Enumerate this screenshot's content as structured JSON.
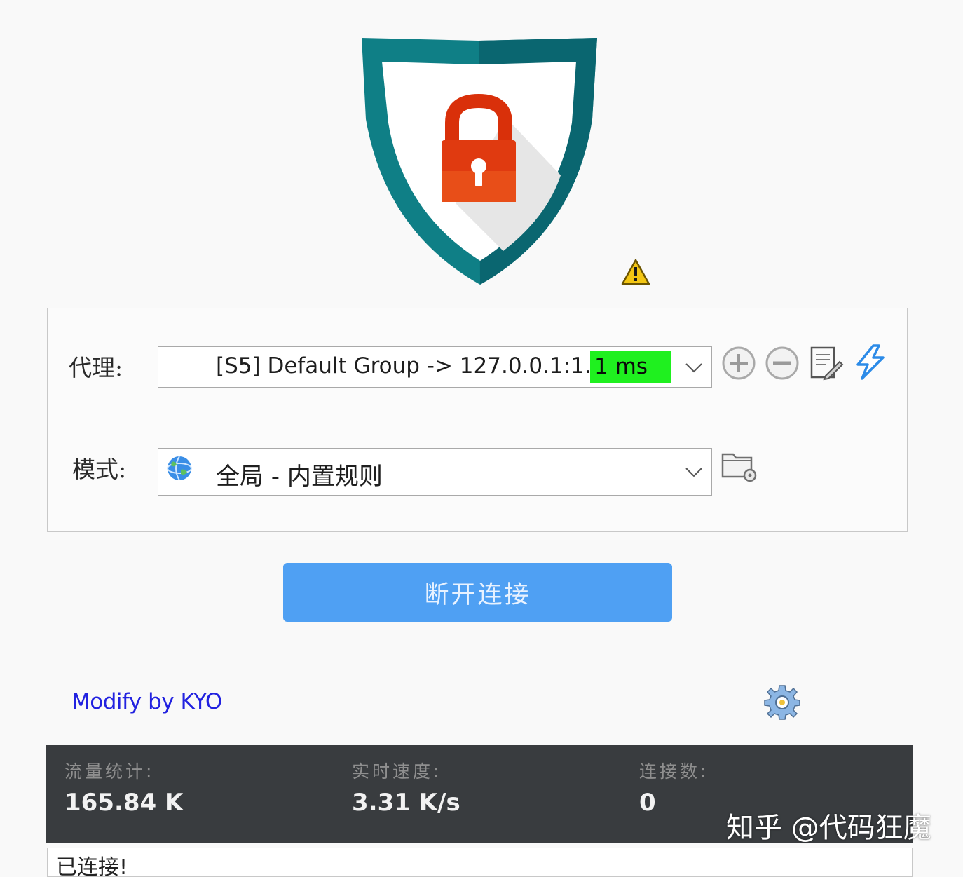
{
  "header": {
    "shield_icon": "shield-lock-icon",
    "status_icon": "warning-icon"
  },
  "proxy": {
    "label": "代理:",
    "value": "[S5] Default Group -> 127.0.0.1:1...",
    "latency": "1 ms",
    "latency_color": "#1ff01f",
    "actions": [
      "add-icon",
      "remove-icon",
      "edit-icon",
      "test-icon"
    ]
  },
  "mode": {
    "label": "模式:",
    "value": "全局 - 内置规则",
    "icon": "globe-icon",
    "action": "folder-settings-icon"
  },
  "connect_button": {
    "label": "断开连接",
    "color": "#4fa0f3"
  },
  "footer": {
    "modify_text": "Modify by KYO",
    "modify_color": "#2222e0",
    "settings_icon": "gear-icon"
  },
  "stats": {
    "traffic_label": "流量统计:",
    "traffic_value": "165.84 K",
    "speed_label": "实时速度:",
    "speed_value": "3.31 K/s",
    "connections_label": "连接数:",
    "connections_value": "0"
  },
  "log": {
    "text": "已连接!"
  },
  "watermark": "知乎 @代码狂魔"
}
